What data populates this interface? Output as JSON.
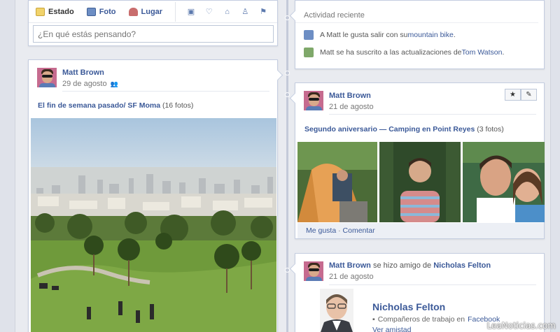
{
  "composer": {
    "tabs": [
      {
        "label": "Estado",
        "icon": "status-icon"
      },
      {
        "label": "Foto",
        "icon": "photo-icon"
      },
      {
        "label": "Lugar",
        "icon": "place-icon"
      }
    ],
    "extra_icons": [
      "life-event-work-icon",
      "life-event-heart-icon",
      "life-event-home-icon",
      "life-event-health-icon",
      "life-event-milestone-icon"
    ],
    "placeholder": "¿En qué estás pensando?"
  },
  "activity": {
    "title": "Actividad reciente",
    "items": [
      {
        "text": "A Matt le gusta salir con su ",
        "link": "mountain bike",
        "suffix": "."
      },
      {
        "text": "Matt se ha suscrito a las actualizaciones de ",
        "link": "Tom Watson",
        "suffix": "."
      }
    ]
  },
  "post_left": {
    "name": "Matt Brown",
    "date": "29 de agosto",
    "album_link": "El fin de semana pasado/ SF Moma",
    "album_count": "(16 fotos)"
  },
  "post_right": {
    "name": "Matt Brown",
    "date": "21 de agosto",
    "album_link": "Segundo aniversario — Camping en Point Reyes",
    "album_count": "(3 fotos)",
    "like": "Me gusta",
    "separator": "·",
    "comment": "Comentar"
  },
  "post_friend": {
    "name": "Matt Brown",
    "verb": "se hizo amigo de",
    "friend": "Nicholas Felton",
    "date": "21 de agosto",
    "card_name": "Nicholas Felton",
    "work_prefix": "Compañeros de trabajo en",
    "work_link": "Facebook",
    "see_friendship": "Ver amistad"
  },
  "watermark": "LeaNoticias.com",
  "colors": {
    "link": "#3b5998",
    "timeline": "#c4cad9",
    "background": "#e9ebf0"
  }
}
